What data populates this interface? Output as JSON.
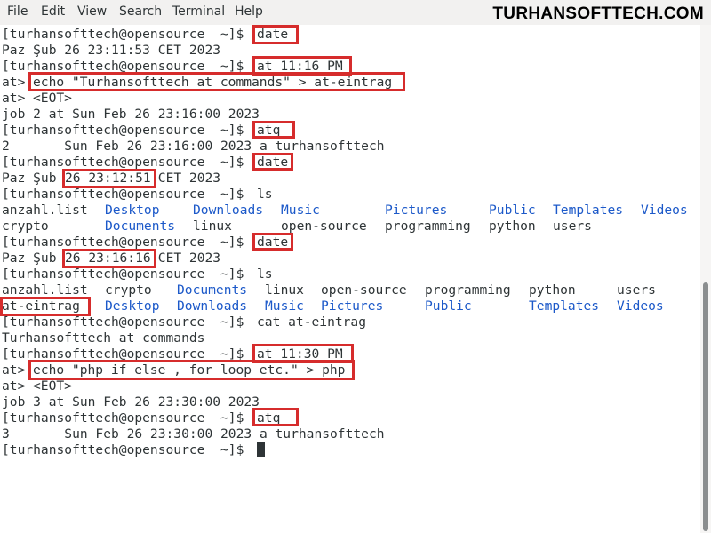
{
  "menubar": {
    "items": [
      "File",
      "Edit",
      "View",
      "Search",
      "Terminal",
      "Help"
    ]
  },
  "watermark": "TURHANSOFTTECH.COM",
  "prompt": "[turhansofttech@opensource  ~]$",
  "at_prompt": "at>",
  "terminal": {
    "l1_cmd": "date",
    "l2_out": "Paz Şub 26 23:11:53 CET 2023",
    "l3_cmd": "at 11:16 PM",
    "l4_cmd": "echo \"Turhansofttech at commands\" > at-eintrag",
    "l5_text": "<EOT>",
    "l6_out": "job 2 at Sun Feb 26 23:16:00 2023",
    "l7_cmd": "atq",
    "l8_out": "2       Sun Feb 26 23:16:00 2023 a turhansofttech",
    "l9_cmd": "date",
    "l10_pre": "Paz Şub ",
    "l10_hi": "26 23:12:51",
    "l10_post": " CET 2023",
    "l11_cmd": "ls",
    "ls1": [
      "anzahl.list",
      "Desktop",
      "Downloads",
      "Music",
      "Pictures",
      "Public",
      "Templates",
      "Videos",
      "crypto",
      "Documents",
      "linux",
      "open-source",
      "programming",
      "python",
      "users"
    ],
    "l14_cmd": "date",
    "l15_pre": "Paz Şub ",
    "l15_hi": "26 23:16:16",
    "l15_post": " CET 2023",
    "l16_cmd": "ls",
    "ls2": [
      "anzahl.list",
      "crypto",
      "Documents",
      "linux",
      "open-source",
      "programming",
      "python",
      "users",
      "at-eintrag",
      "Desktop",
      "Downloads",
      "Music",
      "Pictures",
      "Public",
      "Templates",
      "Videos"
    ],
    "l19_cmd": "cat at-eintrag",
    "l20_out": "Turhansofttech at commands",
    "l21_cmd": "at 11:30 PM",
    "l22_cmd": "echo \"php if else , for loop etc.\" > php",
    "l23_text": "<EOT>",
    "l24_out": "job 3 at Sun Feb 26 23:30:00 2023",
    "l25_cmd": "atq",
    "l26_out": "3       Sun Feb 26 23:30:00 2023 a turhansofttech"
  },
  "colors": {
    "directory": "#1c59c9",
    "highlight_box": "#d62c2c",
    "text": "#2e3436"
  }
}
